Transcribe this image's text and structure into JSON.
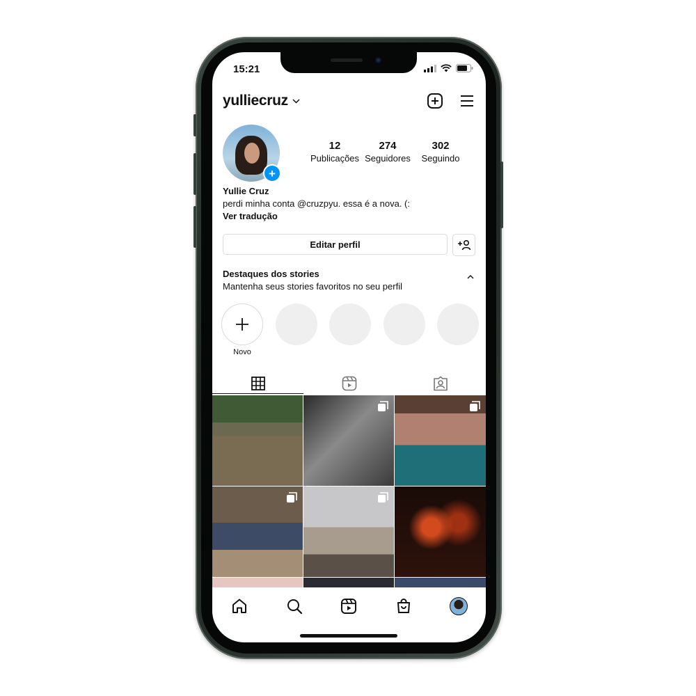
{
  "status_bar": {
    "time": "15:21"
  },
  "header": {
    "username": "yulliecruz"
  },
  "profile": {
    "stats": [
      {
        "value": "12",
        "label": "Publicações"
      },
      {
        "value": "274",
        "label": "Seguidores"
      },
      {
        "value": "302",
        "label": "Seguindo"
      }
    ],
    "full_name": "Yullie Cruz",
    "bio": "perdi minha conta @cruzpyu. essa é a nova. (:",
    "translate_label": "Ver tradução"
  },
  "actions": {
    "edit_profile_label": "Editar perfil"
  },
  "highlights": {
    "title": "Destaques dos stories",
    "subtitle": "Mantenha seus stories favoritos no seu perfil",
    "new_label": "Novo"
  },
  "tabs": {
    "active": "grid"
  },
  "colors": {
    "accent": "#0095f6",
    "border": "#dbdbdb",
    "placeholder": "#efefef"
  }
}
